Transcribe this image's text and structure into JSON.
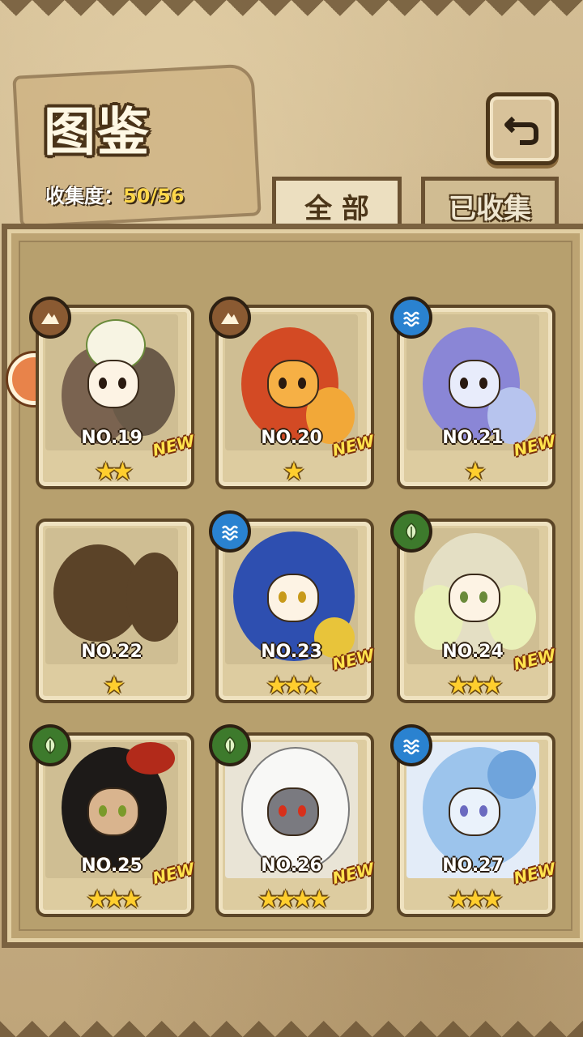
{
  "header": {
    "title": "图鉴",
    "collection_label": "收集度：",
    "collection_value": "50/56"
  },
  "tabs": [
    {
      "label": "全 部",
      "active": true
    },
    {
      "label": "已收集",
      "active": false
    }
  ],
  "cards": [
    {
      "no": "NO.19",
      "stars": "★★",
      "new": "NEW",
      "element": "earth"
    },
    {
      "no": "NO.20",
      "stars": "★",
      "new": "NEW",
      "element": "earth"
    },
    {
      "no": "NO.21",
      "stars": "★",
      "new": "NEW",
      "element": "water"
    },
    {
      "no": "NO.22",
      "stars": "★",
      "new": "",
      "element": ""
    },
    {
      "no": "NO.23",
      "stars": "★★★",
      "new": "NEW",
      "element": "water"
    },
    {
      "no": "NO.24",
      "stars": "★★★",
      "new": "NEW",
      "element": "leaf"
    },
    {
      "no": "NO.25",
      "stars": "★★★",
      "new": "NEW",
      "element": "leaf"
    },
    {
      "no": "NO.26",
      "stars": "★★★★",
      "new": "NEW",
      "element": "leaf"
    },
    {
      "no": "NO.27",
      "stars": "★★★",
      "new": "NEW",
      "element": "water"
    }
  ],
  "colors": {
    "earth": "#8a5a32",
    "water": "#2a82d0",
    "leaf": "#3d7a2c",
    "star": "#ffce2e",
    "new": "#ffe34d"
  }
}
